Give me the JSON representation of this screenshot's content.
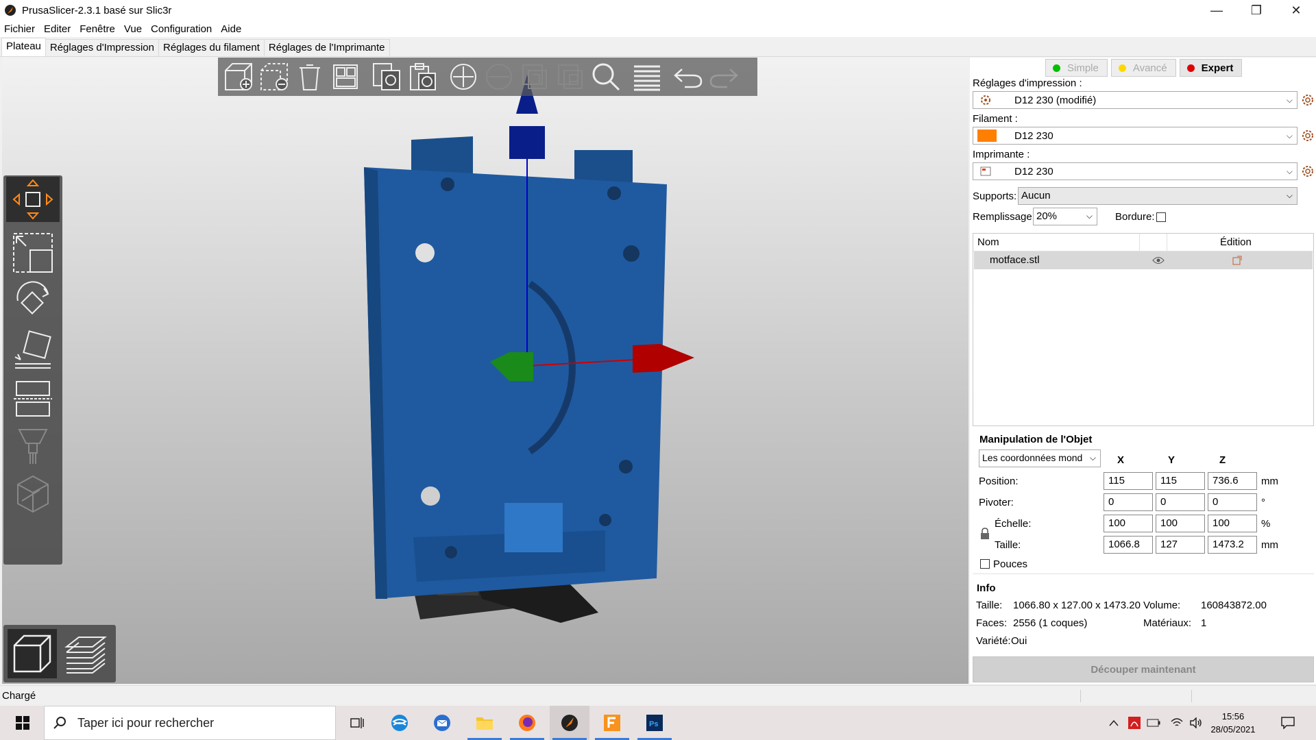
{
  "window": {
    "title": "PrusaSlicer-2.3.1 basé sur Slic3r",
    "buttons": [
      "—",
      "❐",
      "✕"
    ]
  },
  "menu": [
    "Fichier",
    "Editer",
    "Fenêtre",
    "Vue",
    "Configuration",
    "Aide"
  ],
  "tabs": [
    {
      "label": "Plateau",
      "active": true
    },
    {
      "label": "Réglages d'Impression"
    },
    {
      "label": "Réglages du filament"
    },
    {
      "label": "Réglages de l'Imprimante"
    }
  ],
  "mode": {
    "simple": "Simple",
    "advanced": "Avancé",
    "expert": "Expert",
    "colors": {
      "simple": "#00c000",
      "advanced": "#ffd800",
      "expert": "#e00000"
    }
  },
  "presets": {
    "print_label": "Réglages d'impression :",
    "print_value": "D12 230 (modifié)",
    "filament_label": "Filament :",
    "filament_value": "D12 230",
    "filament_color": "#ff8000",
    "printer_label": "Imprimante :",
    "printer_value": "D12 230"
  },
  "options": {
    "supports_label": "Supports:",
    "supports_value": "Aucun",
    "infill_label": "Remplissage:",
    "infill_value": "20%",
    "brim_label": "Bordure:",
    "brim_checked": false
  },
  "object_list": {
    "col_name": "Nom",
    "col_edit": "Édition",
    "rows": [
      {
        "name": "motface.stl"
      }
    ]
  },
  "manipulation": {
    "title": "Manipulation de l'Objet",
    "coord_system": "Les coordonnées mond",
    "axes": [
      "X",
      "Y",
      "Z"
    ],
    "position_label": "Position:",
    "position": [
      "115",
      "115",
      "736.6"
    ],
    "position_unit": "mm",
    "rotation_label": "Pivoter:",
    "rotation": [
      "0",
      "0",
      "0"
    ],
    "rotation_unit": "°",
    "scale_label": "Échelle:",
    "scale": [
      "100",
      "100",
      "100"
    ],
    "scale_unit": "%",
    "size_label": "Taille:",
    "size": [
      "1066.8",
      "127",
      "1473.2"
    ],
    "size_unit": "mm",
    "inches_label": "Pouces",
    "inches_checked": false
  },
  "info": {
    "title": "Info",
    "size_label": "Taille:",
    "size_value": "1066.80 x 127.00 x 1473.20",
    "volume_label": "Volume:",
    "volume_value": "160843872.00",
    "facets_label": "Faces:",
    "facets_value": "2556 (1 coques)",
    "materials_label": "Matériaux:",
    "materials_value": "1",
    "manifold_label": "Variété:",
    "manifold_value": "Oui"
  },
  "slice_button": "Découper maintenant",
  "status": "Chargé",
  "taskbar": {
    "search_placeholder": "Taper ici pour rechercher",
    "time": "15:56",
    "date": "28/05/2021"
  }
}
